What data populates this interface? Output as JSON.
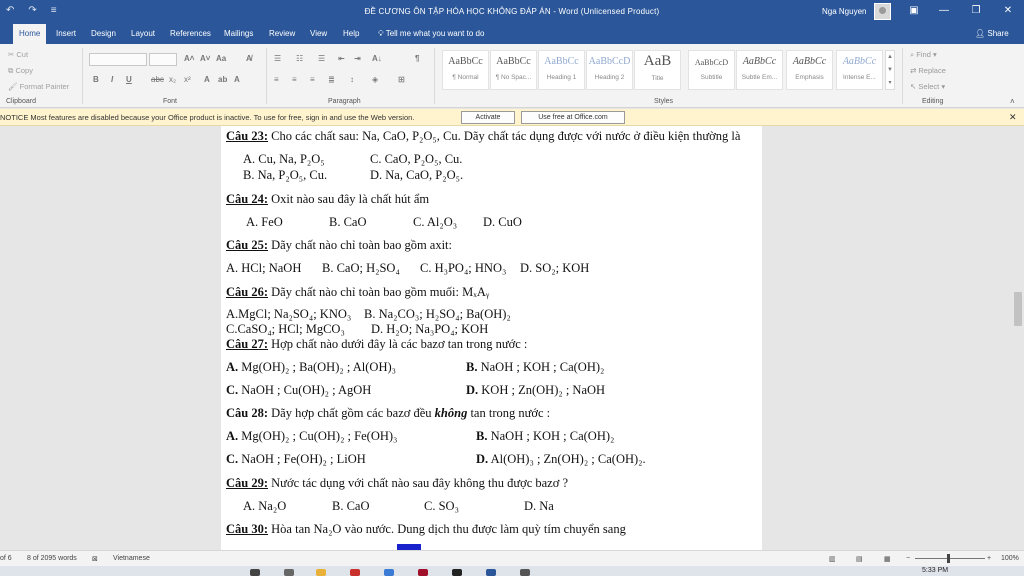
{
  "titlebar": {
    "title": "ĐỀ CƯƠNG ÔN TẬP HÓA HỌC KHÔNG ĐÁP ÁN  -  Word (Unlicensed Product)",
    "user": "Nga Nguyen"
  },
  "tabs": [
    "Home",
    "Insert",
    "Design",
    "Layout",
    "References",
    "Mailings",
    "Review",
    "View",
    "Help"
  ],
  "tell_me": "Tell me what you want to do",
  "share": "Share",
  "clipboard": {
    "cut": "Cut",
    "copy": "Copy",
    "format_painter": "Format Painter",
    "label": "Clipboard"
  },
  "font_group": {
    "label": "Font",
    "buttons": [
      "B",
      "I",
      "U",
      "abc",
      "x₂",
      "x²",
      "A"
    ]
  },
  "paragraph_group": {
    "label": "Paragraph"
  },
  "styles_group": {
    "label": "Styles",
    "tiles": [
      {
        "sample": "AaBbCc",
        "name": "¶ Normal"
      },
      {
        "sample": "AaBbCc",
        "name": "¶ No Spac..."
      },
      {
        "sample": "AaBbCc",
        "name": "Heading 1"
      },
      {
        "sample": "AaBbCcD",
        "name": "Heading 2"
      },
      {
        "sample": "AaB",
        "name": "Title"
      },
      {
        "sample": "AaBbCcD",
        "name": "Subtitle"
      },
      {
        "sample": "AaBbCc",
        "name": "Subtle Em..."
      },
      {
        "sample": "AaBbCc",
        "name": "Emphasis"
      },
      {
        "sample": "AaBbCc",
        "name": "Intense E..."
      }
    ]
  },
  "editing_group": {
    "find": "Find",
    "replace": "Replace",
    "select": "Select",
    "label": "Editing"
  },
  "notice": {
    "text": "NOTICE   Most features are disabled because your Office product is inactive. To use for free, sign in and use the Web version.",
    "activate": "Activate",
    "web": "Use free at Office.com"
  },
  "doc": {
    "q23_label": "Câu 23:",
    "q23_text": " Cho các chất sau: Na, CaO, P₂O₅, Cu. Dãy chất tác dụng được với nước ở điều kiện thường là",
    "q23_a": "A. Cu, Na, P₂O₅",
    "q23_c": "C. CaO, P₂O₅, Cu.",
    "q23_b": "B. Na, P₂O₅, Cu.",
    "q23_d": "D. Na, CaO, P₂O₅.",
    "q24_label": "Câu 24:",
    "q24_text": " Oxit nào sau đây là chất hút ẩm",
    "q24_a": "A. FeO",
    "q24_b": "B. CaO",
    "q24_c": "C. Al₂O₃",
    "q24_d": "D. CuO",
    "q25_label": "Câu 25:",
    "q25_text": " Dãy chất nào chỉ toàn bao gồm axit:",
    "q25_a": "A. HCl; NaOH",
    "q25_b": "B. CaO; H₂SO₄",
    "q25_c": "C. H₃PO₄; HNO₃",
    "q25_d": "D. SO₂; KOH",
    "q26_label": "Câu 26:",
    "q26_text": " Dãy chất nào chỉ toàn bao gồm muối: MₓAᵧ",
    "q26_a": "A.MgCl; Na₂SO₄; KNO₃",
    "q26_b": "B. Na₂CO₃; H₂SO₄; Ba(OH)₂",
    "q26_c": "C.CaSO₄; HCl; MgCO₃",
    "q26_d": "D. H₂O; Na₃PO₄; KOH",
    "q27_label": "Câu 27:",
    "q27_text": " Hợp chất  nào dưới đây là các bazơ tan trong nước :",
    "q27_a_l": "A.",
    "q27_a": " Mg(OH)₂ ; Ba(OH)₂ ; Al(OH)₃",
    "q27_b_l": "B.",
    "q27_b": " NaOH ; KOH ; Ca(OH)₂",
    "q27_c_l": "C.",
    "q27_c": " NaOH ; Cu(OH)₂ ; AgOH",
    "q27_d_l": "D.",
    "q27_d": "  KOH ; Zn(OH)₂ ; NaOH",
    "q28_label": "Câu 28:",
    "q28_text_1": "  Dãy hợp chất gồm các bazơ đều ",
    "q28_text_em": "không",
    "q28_text_2": " tan trong nước :",
    "q28_a_l": "A.",
    "q28_a": "  Mg(OH)₂ ; Cu(OH)₂ ; Fe(OH)₃",
    "q28_b_l": "B.",
    "q28_b": "  NaOH ; KOH ; Ca(OH)₂",
    "q28_c_l": "C.",
    "q28_c": "  NaOH ; Fe(OH)₂ ; LiOH",
    "q28_d_l": "D.",
    "q28_d": "  Al(OH)₃ ; Zn(OH)₂ ; Ca(OH)₂.",
    "q29_label": "Câu 29:",
    "q29_text": " Nước tác dụng với chất nào sau đây không thu được bazơ ?",
    "q29_a": "A. Na₂O",
    "q29_b": "B. CaO",
    "q29_c": "C. SO₃",
    "q29_d": "D. Na",
    "q30_label": "Câu 30:",
    "q30_text": " Hòa tan Na₂O vào nước. Dung dịch thu được làm quỳ tím chuyển sang"
  },
  "status": {
    "page": "of 6",
    "words": "8 of 2095 words",
    "language": "Vietnamese",
    "zoom": "100%"
  },
  "taskbar": {
    "time": "5:33 PM"
  }
}
